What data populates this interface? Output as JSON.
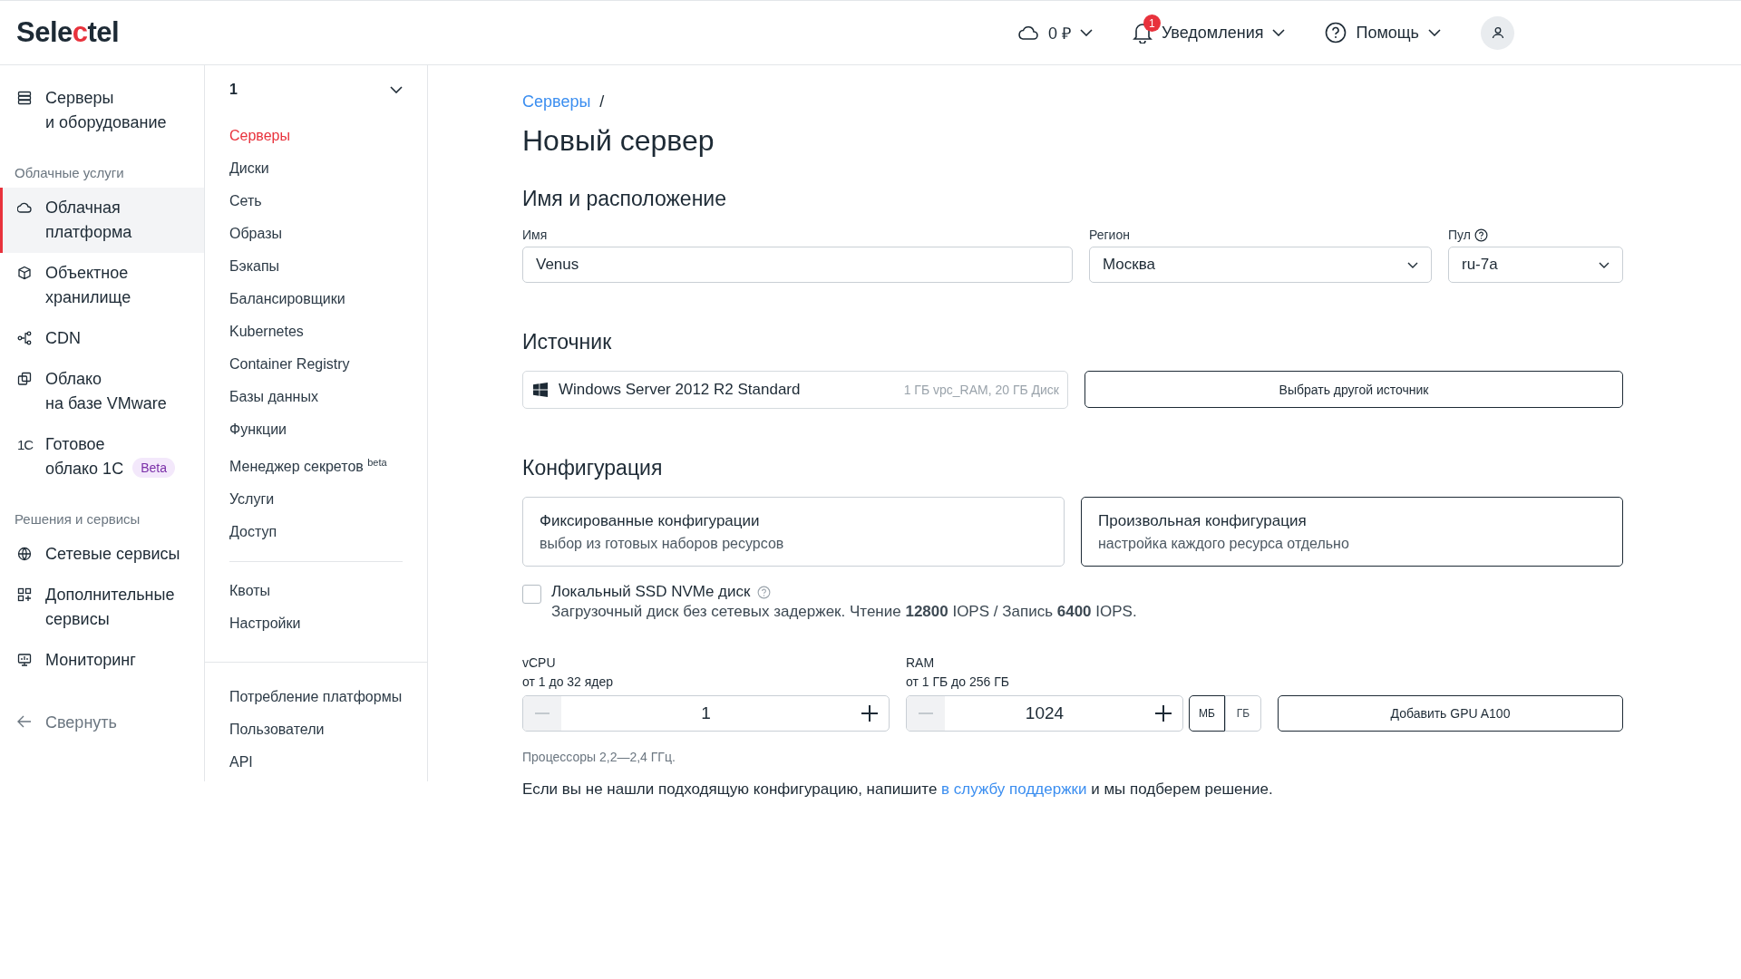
{
  "header": {
    "logo_start": "Sele",
    "logo_accent": "c",
    "logo_end": "tel",
    "balance": "0 ₽",
    "notifications": {
      "label": "Уведомления",
      "badge": "1"
    },
    "help": "Помощь"
  },
  "sidebar": {
    "items": [
      {
        "kind": "item",
        "label": "Серверы\nи оборудование",
        "selected": false
      },
      {
        "kind": "heading",
        "label": "Облачные услуги"
      },
      {
        "kind": "item",
        "label": "Облачная\nплатформа",
        "selected": true
      },
      {
        "kind": "item",
        "label": "Объектное\nхранилище",
        "selected": false
      },
      {
        "kind": "item",
        "label": "CDN",
        "selected": false
      },
      {
        "kind": "item",
        "label": "Облако\nна базе VMware",
        "selected": false
      },
      {
        "kind": "item",
        "label": "Готовое\nоблако 1С",
        "selected": false,
        "mark": "1С",
        "badge": "Beta"
      },
      {
        "kind": "heading",
        "label": "Решения и сервисы"
      },
      {
        "kind": "item",
        "label": "Сетевые сервисы",
        "selected": false
      },
      {
        "kind": "item",
        "label": "Дополнительные\nсервисы",
        "selected": false
      },
      {
        "kind": "item",
        "label": "Мониторинг",
        "selected": false
      }
    ],
    "collapse": "Свернуть"
  },
  "subnav": {
    "project": "1",
    "groups": [
      [
        {
          "label": "Серверы",
          "selected": true
        },
        {
          "label": "Диски",
          "selected": false
        },
        {
          "label": "Сеть",
          "selected": false
        },
        {
          "label": "Образы",
          "selected": false
        },
        {
          "label": "Бэкапы",
          "selected": false
        },
        {
          "label": "Балансировщики",
          "selected": false
        },
        {
          "label": "Kubernetes",
          "selected": false
        },
        {
          "label": "Container Registry",
          "selected": false
        },
        {
          "label": "Базы данных",
          "selected": false
        },
        {
          "label": "Функции",
          "selected": false
        },
        {
          "label": "Менеджер секретов $^{beta}$",
          "selected": false
        },
        {
          "label": "Услуги",
          "selected": false
        },
        {
          "label": "Доступ",
          "selected": false
        }
      ],
      [
        {
          "label": "Квоты",
          "selected": false
        },
        {
          "label": "Настройки",
          "selected": false
        }
      ]
    ],
    "footer": [
      {
        "label": "Потребление платформы",
        "selected": false
      },
      {
        "label": "Пользователи",
        "selected": false
      },
      {
        "label": "API",
        "selected": false
      }
    ]
  },
  "breadcrumb": {
    "link": "Серверы",
    "separator": "/"
  },
  "title": "Новый сервер",
  "location": {
    "heading": "Имя и расположение",
    "name": {
      "label": "Имя",
      "value": "Venus"
    },
    "region": {
      "label": "Регион",
      "value": "Москва"
    },
    "pool": {
      "label": "Пул",
      "value": "ru-7a"
    }
  },
  "source": {
    "heading": "Источник",
    "image": "Windows Server 2012 R2 Standard",
    "specs": "1 ГБ vpc_RAM, 20 ГБ Диск",
    "button": "Выбрать другой источник"
  },
  "configuration": {
    "heading": "Конфигурация",
    "modes": [
      {
        "title": "Фиксированные конфигурации",
        "subtitle": "выбор из готовых наборов ресурсов",
        "selected": false
      },
      {
        "title": "Произвольная конфигурация",
        "subtitle": "настройка каждого ресурса отдельно",
        "selected": true
      }
    ],
    "local_ssd": {
      "label": "Локальный SSD NVMe диск",
      "checked": false,
      "description": "Загрузочный диск без сетевых задержек. Чтение **12800** IOPS / Запись **6400** IOPS."
    },
    "vcpu": {
      "label": "vCPU",
      "hint": "от 1 до 32 ядер",
      "value": "1",
      "decrement_disabled": true
    },
    "ram": {
      "label": "RAM",
      "hint": "от 1 ГБ до 256 ГБ",
      "value": "1024",
      "decrement_disabled": true,
      "units": [
        {
          "label": "МБ",
          "selected": true
        },
        {
          "label": "ГБ",
          "selected": false
        }
      ]
    },
    "gpu_button": "Добавить GPU A100",
    "cpu_note": "Процессоры 2,2—2,4 ГГц.",
    "support": {
      "before": "Если вы не нашли подходящую конфигурацию, напишите ",
      "link": "в службу поддержки",
      "after": " и мы подберем решение."
    }
  }
}
